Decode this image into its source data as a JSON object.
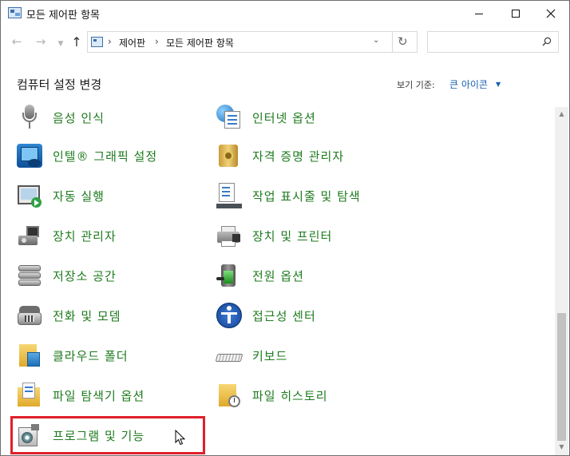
{
  "window": {
    "title": "모든 제어판 항목"
  },
  "navigation": {
    "breadcrumbs": [
      "제어판",
      "모든 제어판 항목"
    ],
    "search_placeholder": ""
  },
  "header": {
    "title": "컴퓨터 설정 변경",
    "view_by_label": "보기 기준:",
    "view_by_value": "큰 아이콘"
  },
  "items": {
    "speech": "음성 인식",
    "internet_options": "인터넷 옵션",
    "intel_graphics": "인텔® 그래픽 설정",
    "credential_manager": "자격 증명 관리자",
    "autoplay": "자동 실행",
    "taskbar_navigation": "작업 표시줄 및 탐색",
    "device_manager": "장치 관리자",
    "devices_printers": "장치 및 프린터",
    "storage_spaces": "저장소 공간",
    "power_options": "전원 옵션",
    "phone_modem": "전화 및 모뎀",
    "ease_of_access": "접근성 센터",
    "work_folders": "클라우드 폴더",
    "keyboard": "키보드",
    "file_explorer_options": "파일 탐색기 옵션",
    "file_history": "파일 히스토리",
    "programs_features": "프로그램 및 기능"
  },
  "colors": {
    "item_text": "#1e7a1e",
    "link_blue": "#1a5fb4",
    "highlight_border": "#e0202a"
  }
}
